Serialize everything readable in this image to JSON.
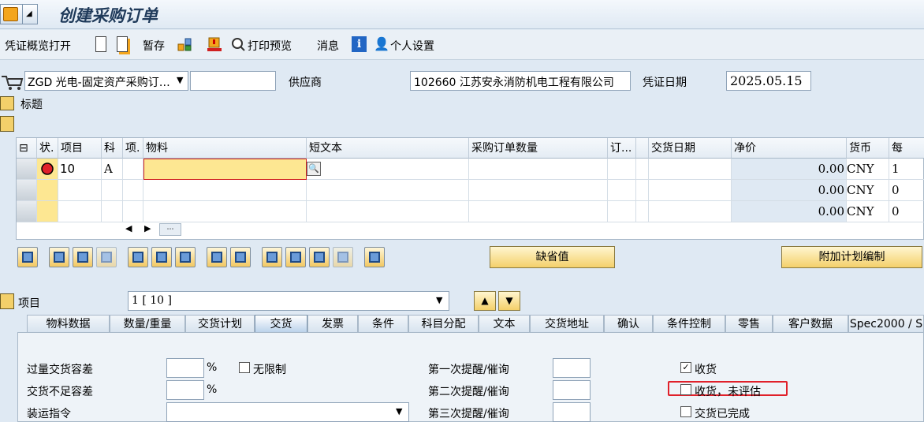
{
  "title": "创建采购订单",
  "toolbar": {
    "overview_label": "凭证概览打开",
    "hold_label": "暂存",
    "print_preview_label": "打印预览",
    "messages_label": "消息",
    "personal_settings_label": "个人设置"
  },
  "header": {
    "order_type": "ZGD 光电-固定资产采购订…",
    "po_number": "",
    "vendor_label": "供应商",
    "vendor_value": "102660 江苏安永消防机电工程有限公司",
    "doc_date_label": "凭证日期",
    "doc_date_value": "2025.05.15",
    "header_label": "标题"
  },
  "grid": {
    "columns": [
      "状.",
      "项目",
      "科",
      "项.",
      "物料",
      "短文本",
      "采购订单数量",
      "订...",
      "",
      "交货日期",
      "净价",
      "货币",
      "每"
    ],
    "rows": [
      {
        "item": "10",
        "acct": "A",
        "material": "",
        "price": "0.00",
        "currency": "CNY",
        "per": "1"
      },
      {
        "item": "",
        "acct": "",
        "material": "",
        "price": "0.00",
        "currency": "CNY",
        "per": "0"
      },
      {
        "item": "",
        "acct": "",
        "material": "",
        "price": "0.00",
        "currency": "CNY",
        "per": "0"
      }
    ]
  },
  "buttons": {
    "default_values": "缺省值",
    "additional_planning": "附加计划编制"
  },
  "item_selector": {
    "label": "项目",
    "value": "1 [ 10 ]"
  },
  "tabs": [
    "物料数据",
    "数量/重量",
    "交货计划",
    "交货",
    "发票",
    "条件",
    "科目分配",
    "文本",
    "交货地址",
    "确认",
    "条件控制",
    "零售",
    "客户数据",
    "Spec2000 / S"
  ],
  "delivery": {
    "overdelivery_label": "过量交货容差",
    "overdelivery_unit": "%",
    "unlimited_label": "无限制",
    "underdelivery_label": "交货不足容差",
    "underdelivery_unit": "%",
    "shipping_label": "装运指令",
    "reminder1_label": "第一次提醒/催询",
    "reminder2_label": "第二次提醒/催询",
    "reminder3_label": "第三次提醒/催询",
    "gr_label": "收货",
    "gr_nonvaluated_label": "收货，未评估",
    "delivery_completed_label": "交货已完成"
  },
  "colors": {
    "accent": "#1f3a5a",
    "highlight_box": "#e0202a",
    "status_red": "#e0202a"
  }
}
